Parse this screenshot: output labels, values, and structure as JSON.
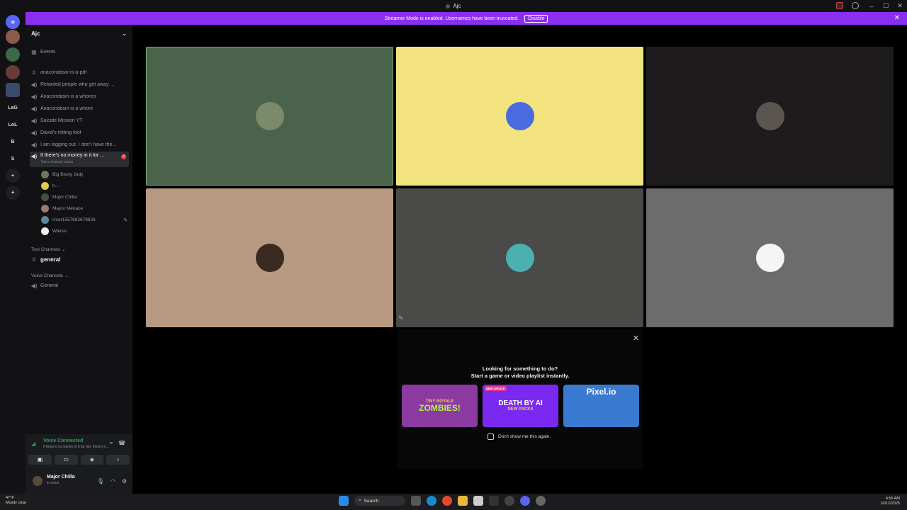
{
  "window": {
    "title": "Ajc"
  },
  "banner": {
    "text": "Streamer Mode is enabled. Usernames have been truncated.",
    "button": "Disable"
  },
  "servers": [
    {
      "label": "LaG"
    },
    {
      "label": "LoL"
    },
    {
      "label": "B"
    },
    {
      "label": "S"
    }
  ],
  "guild": {
    "name": "Ajc"
  },
  "channels": [
    {
      "icon": "calendar",
      "label": "Events"
    },
    {
      "icon": "#",
      "label": "anacondasin-is-a-pdf"
    },
    {
      "icon": "speaker",
      "label": "Retarded people who get away ..."
    },
    {
      "icon": "speaker",
      "label": "Anacondasin is a whoreo"
    },
    {
      "icon": "speaker",
      "label": "Anacondasin is a whore"
    },
    {
      "icon": "speaker",
      "label": "Suicide Mission YT"
    },
    {
      "icon": "speaker",
      "label": "David's rotting foot"
    },
    {
      "icon": "speaker",
      "label": "I am logging out. I don't have the..."
    },
    {
      "icon": "speaker",
      "label": "If there's no money in it for ...",
      "badge": "3"
    }
  ],
  "channel_status": "Set a channel status",
  "voice_users": [
    {
      "name": "Big Booty Judy"
    },
    {
      "name": "h..."
    },
    {
      "name": "Major Chilla"
    },
    {
      "name": "Mayor Menace"
    },
    {
      "name": "User1557882678826"
    },
    {
      "name": "Walrus"
    }
  ],
  "categories": {
    "text": "Text Channels",
    "text_channel": "general",
    "voice": "Voice Channels",
    "voice_channel": "General"
  },
  "voice_panel": {
    "status": "Voice Connected",
    "sub": "If there's no money in it for me, there's n...",
    "user": "Major Chilla",
    "user_status": "In voice"
  },
  "activity": {
    "line1": "Looking for something to do?",
    "line2": "Start a game or video playlist instantly.",
    "cards": [
      "ZOMBIES!",
      "DEATH BY AI",
      "Pixel.io"
    ],
    "card_sub": {
      "tiny_royale": "TINY ROYALE",
      "new_packs": "NEW PACKS",
      "new_update": "NEW UPDATE"
    },
    "dont_show": "Don't show me this again."
  },
  "taskbar": {
    "temp": "47°F",
    "weather": "Mostly clear",
    "search": "Search",
    "time": "4:56 AM",
    "date": "10/12/2025"
  },
  "colors": {
    "tile1": "#4b634b",
    "tile2": "#f2e37f",
    "tile3": "#1e1b1c",
    "tile4": "#b89a82",
    "tile5": "#4a4a48",
    "tile6": "#6c6c6c",
    "banner": "#8a2ff0"
  }
}
